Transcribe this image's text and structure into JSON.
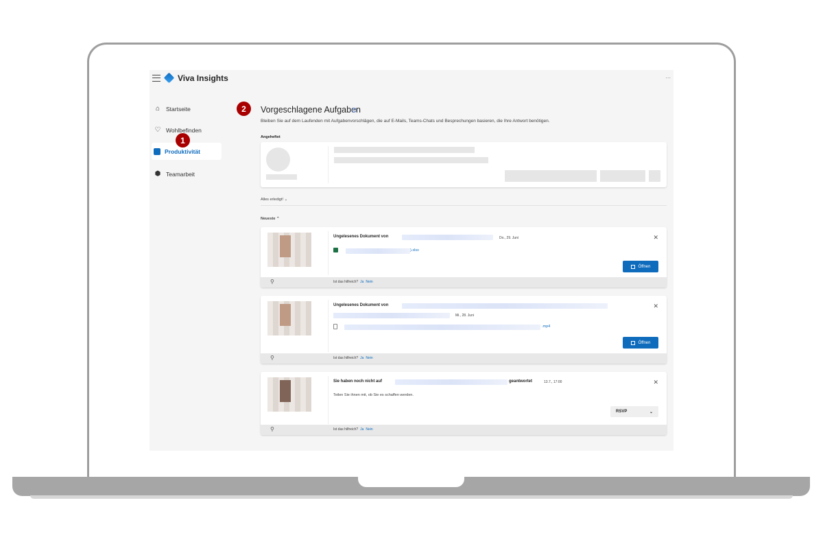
{
  "app": {
    "title": "Viva Insights",
    "more_label": "..."
  },
  "sidebar": {
    "items": [
      {
        "label": "Startseite",
        "icon": "home-icon"
      },
      {
        "label": "Wohlbefinden",
        "icon": "heart-icon"
      },
      {
        "label": "Produktivität",
        "icon": "calendar-icon",
        "active": true
      },
      {
        "label": "Teamarbeit",
        "icon": "team-icon"
      }
    ]
  },
  "markers": {
    "one": "1",
    "two": "2"
  },
  "main": {
    "title": "Vorgeschlagene Aufgaben",
    "subtitle": "Bleiben Sie auf dem Laufenden mit Aufgabenvorschlägen, die auf E-Mails, Teams-Chats und Besprechungen basieren, die Ihre Antwort benötigen.",
    "pinned_label": "Angeheftet",
    "done_label": "Alles erledigt!",
    "newest_label": "Neueste"
  },
  "cards": [
    {
      "title": "Ungelesenes Dokument von",
      "date": "Do., 29. Juni",
      "file": ").xlsx",
      "button": "Öffnen",
      "helpful": "Ist das hilfreich?",
      "yes": "Ja",
      "no": "Nein"
    },
    {
      "title": "Ungelesenes Dokument von",
      "date": "Mi., 28. Juni",
      "file": ".mp4",
      "button": "Öffnen",
      "helpful": "Ist das hilfreich?",
      "yes": "Ja",
      "no": "Nein"
    },
    {
      "title": "Sie haben noch nicht auf",
      "title_end": "geantwortet",
      "date": "13.7., 17:00",
      "description": "Teilen Sie ihnen mit, ob Sie es schaffen werden.",
      "button": "RSVP",
      "helpful": "Ist das hilfreich?",
      "yes": "Ja",
      "no": "Nein"
    }
  ],
  "colors": {
    "accent": "#0f6cbd",
    "marker": "#a80000"
  }
}
